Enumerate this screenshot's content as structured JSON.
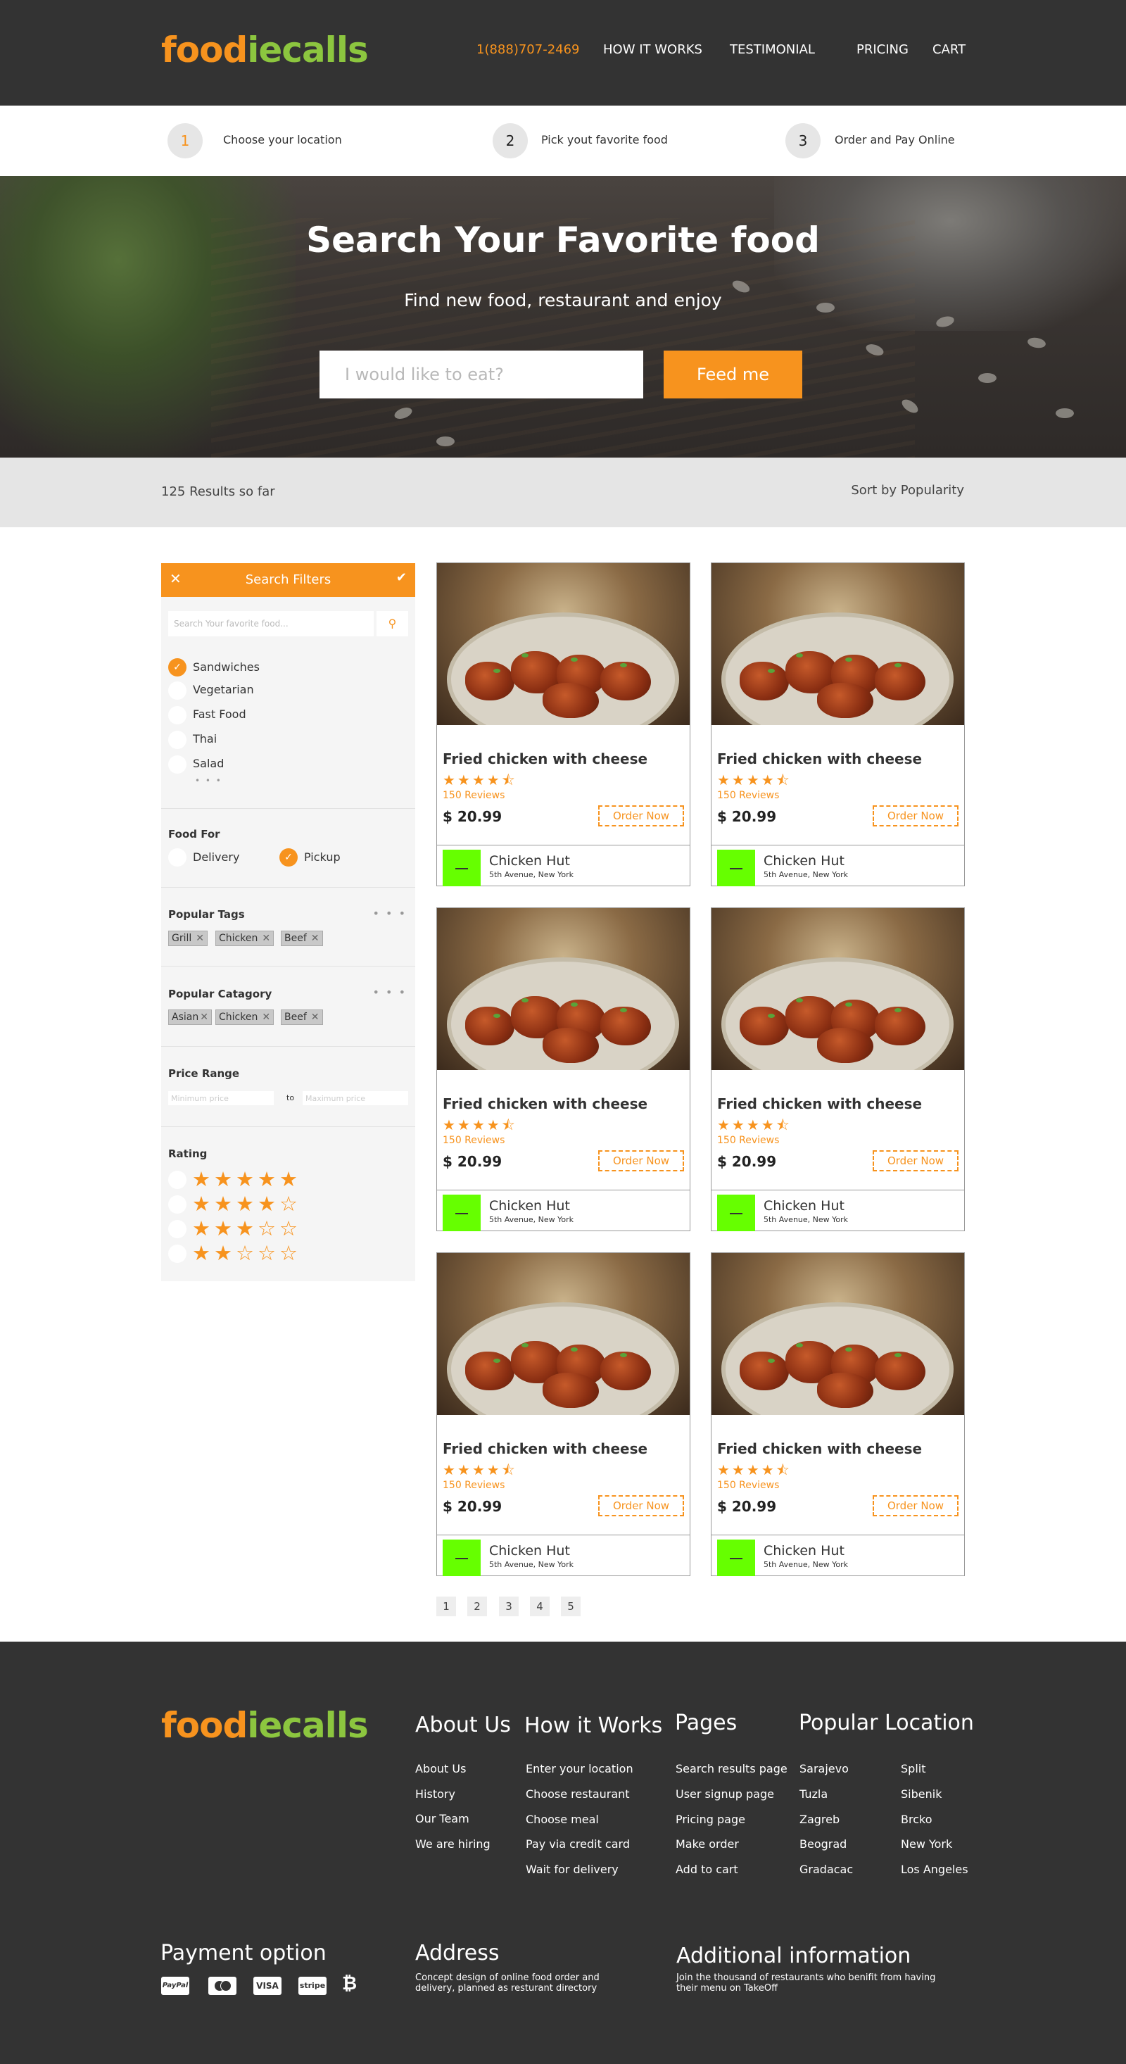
{
  "brand": {
    "logo_part1": "food",
    "logo_part2": "ecalls",
    "logo_i": "i"
  },
  "nav": {
    "phone": "1(888)707-2469",
    "how_it_works": "HOW IT WORKS",
    "testimonial": "TESTIMONIAL",
    "pricing": "PRICING",
    "cart": "CART"
  },
  "steps": [
    {
      "num": "1",
      "label": "Choose your location"
    },
    {
      "num": "2",
      "label": "Pick yout favorite food"
    },
    {
      "num": "3",
      "label": "Order and Pay Online"
    }
  ],
  "hero": {
    "title": "Search Your Favorite food",
    "subtitle": "Find new food, restaurant and enjoy",
    "search_placeholder": "I would like to eat?",
    "button": "Feed me"
  },
  "results": {
    "count_text": "125 Results so far",
    "sort_text": "Sort by Popularity"
  },
  "filters": {
    "title": "Search Filters",
    "search_placeholder": "Search Your favorite food...",
    "categories": [
      "Sandwiches",
      "Vegetarian",
      "Fast Food",
      "Thai",
      "Salad"
    ],
    "food_for_title": "Food For",
    "food_for": [
      "Delivery",
      "Pickup"
    ],
    "popular_tags_title": "Popular Tags",
    "popular_tags": [
      "Grill",
      "Chicken",
      "Beef"
    ],
    "popular_category_title": "Popular Catagory",
    "popular_categories": [
      "Asian",
      "Chicken",
      "Beef"
    ],
    "price_range_title": "Price Range",
    "min_placeholder": "Minimum price",
    "max_placeholder": "Maximum price",
    "to_label": "to",
    "rating_title": "Rating",
    "ratings": [
      5,
      4,
      3,
      2
    ],
    "more": "• • •"
  },
  "products": [
    {
      "name": "Fried chicken with cheese",
      "rating": 4.5,
      "reviews": "150 Reviews",
      "price": "$ 20.99",
      "order": "Order Now",
      "restaurant": "Chicken Hut",
      "address": "5th Avenue, New York"
    },
    {
      "name": "Fried chicken with cheese",
      "rating": 4.5,
      "reviews": "150 Reviews",
      "price": "$ 20.99",
      "order": "Order Now",
      "restaurant": "Chicken Hut",
      "address": "5th Avenue, New York"
    },
    {
      "name": "Fried chicken with cheese",
      "rating": 4.5,
      "reviews": "150 Reviews",
      "price": "$ 20.99",
      "order": "Order Now",
      "restaurant": "Chicken Hut",
      "address": "5th Avenue, New York"
    },
    {
      "name": "Fried chicken with cheese",
      "rating": 4.5,
      "reviews": "150 Reviews",
      "price": "$ 20.99",
      "order": "Order Now",
      "restaurant": "Chicken Hut",
      "address": "5th Avenue, New York"
    },
    {
      "name": "Fried chicken with cheese",
      "rating": 4.5,
      "reviews": "150 Reviews",
      "price": "$ 20.99",
      "order": "Order Now",
      "restaurant": "Chicken Hut",
      "address": "5th Avenue, New York"
    },
    {
      "name": "Fried chicken with cheese",
      "rating": 4.5,
      "reviews": "150 Reviews",
      "price": "$ 20.99",
      "order": "Order Now",
      "restaurant": "Chicken Hut",
      "address": "5th Avenue, New York"
    }
  ],
  "pagination": [
    "1",
    "2",
    "3",
    "4",
    "5"
  ],
  "footer": {
    "about": {
      "title": "About Us",
      "links": [
        "About Us",
        "History",
        "Our Team",
        "We are hiring"
      ]
    },
    "how": {
      "title": "How it Works",
      "links": [
        "Enter your location",
        "Choose restaurant",
        "Choose meal",
        "Pay via credit card",
        "Wait for delivery"
      ]
    },
    "pages": {
      "title": "Pages",
      "links": [
        "Search results page",
        "User signup page",
        "Pricing page",
        "Make order",
        "Add to cart"
      ]
    },
    "popular": {
      "title": "Popular Location",
      "col1": [
        "Sarajevo",
        "Tuzla",
        "Zagreb",
        "Beograd",
        "Gradacac"
      ],
      "col2": [
        "Split",
        "Sibenik",
        "Brcko",
        "New York",
        "Los Angeles"
      ]
    },
    "payment": {
      "title": "Payment option",
      "methods": [
        "PayPal",
        "MasterCard",
        "VISA",
        "stripe",
        "Bitcoin"
      ]
    },
    "address": {
      "title": "Address",
      "text": "Concept design of online food order and delivery, planned as resturant directory"
    },
    "additional": {
      "title": "Additional information",
      "text": "Join the thousand of restaurants who benifit from having their menu on TakeOff"
    }
  },
  "colors": {
    "accent": "#f7931e",
    "green": "#8cc63f",
    "dark": "#333333",
    "restaurant_logo": "#66ff00"
  }
}
